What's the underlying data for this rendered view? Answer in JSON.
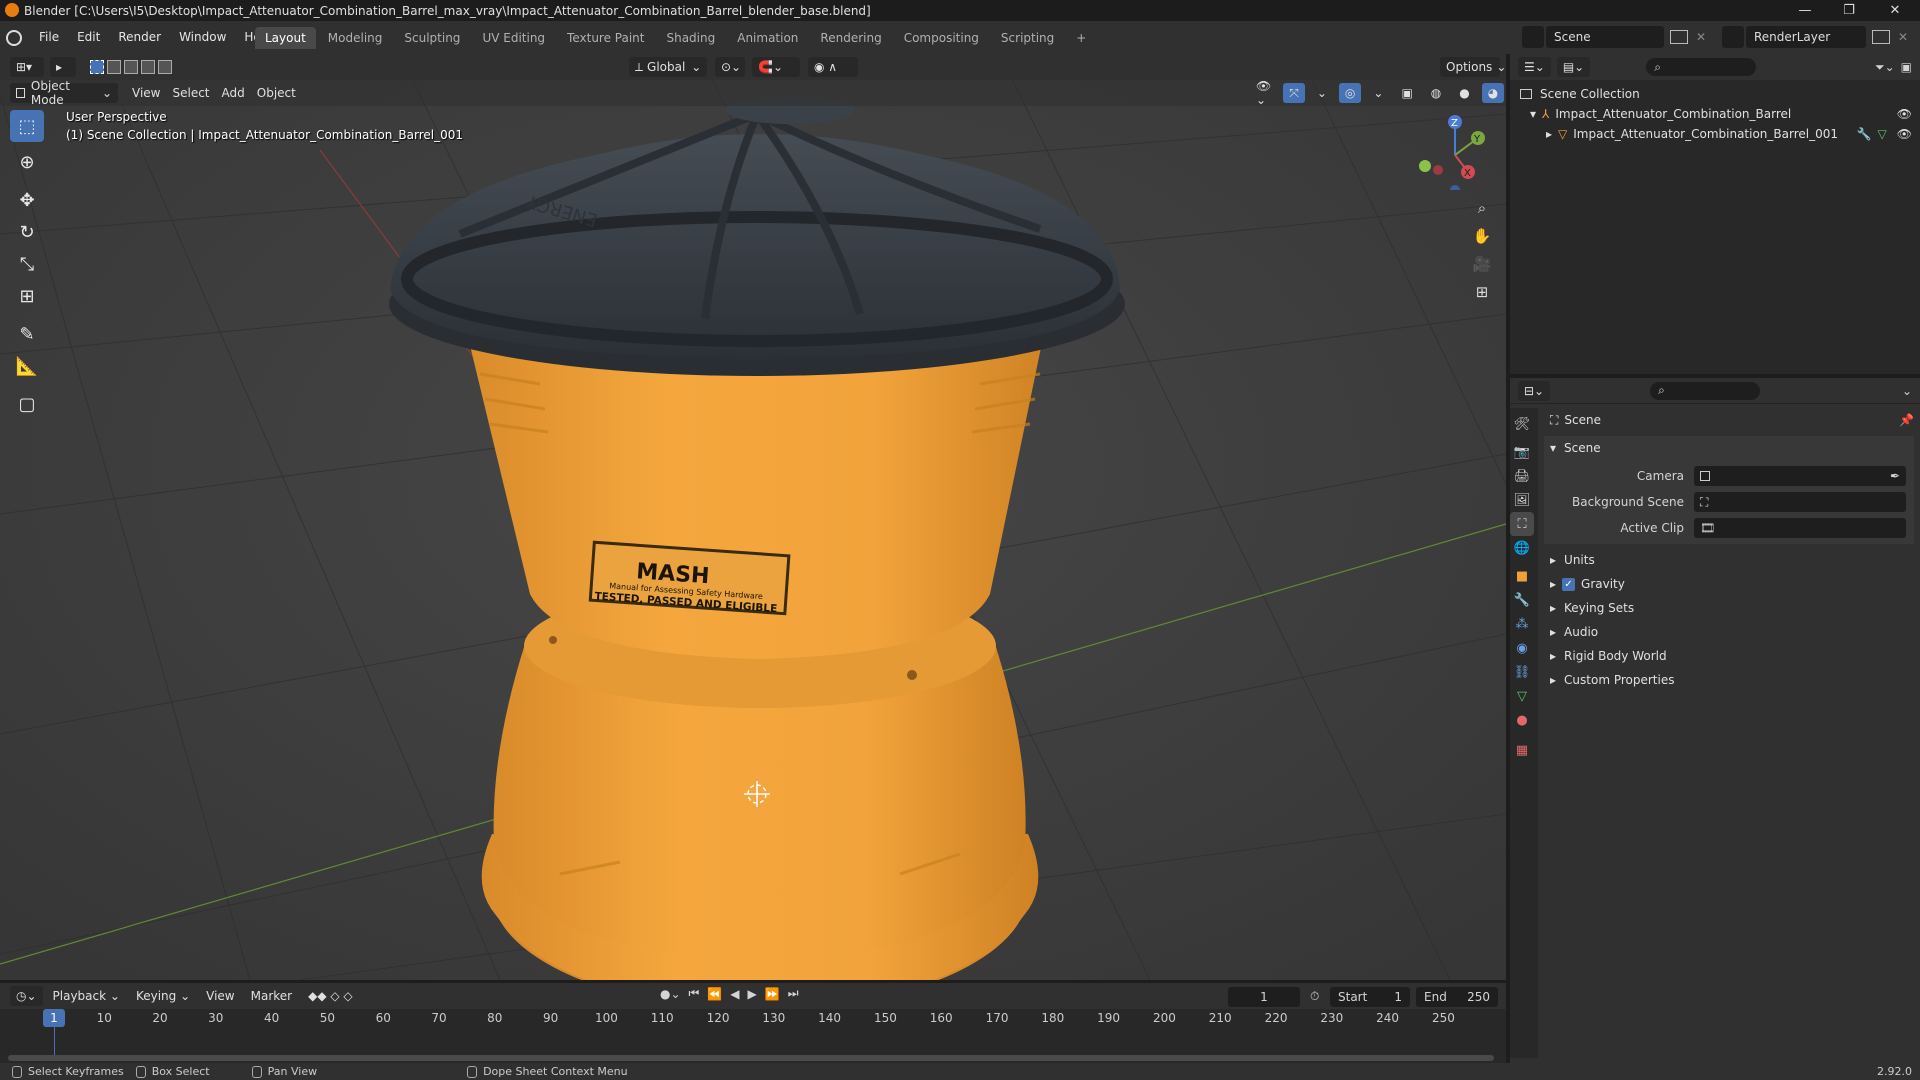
{
  "titlebar": {
    "title": "Blender [C:\\Users\\I5\\Desktop\\Impact_Attenuator_Combination_Barrel_max_vray\\Impact_Attenuator_Combination_Barrel_blender_base.blend]",
    "minimize": "—",
    "maximize": "❐",
    "close": "✕"
  },
  "menu": {
    "items": [
      "File",
      "Edit",
      "Render",
      "Window",
      "Help"
    ],
    "workspaces": [
      "Layout",
      "Modeling",
      "Sculpting",
      "UV Editing",
      "Texture Paint",
      "Shading",
      "Animation",
      "Rendering",
      "Compositing",
      "Scripting"
    ],
    "active_workspace": "Layout",
    "add_workspace": "+",
    "scene_name": "Scene",
    "render_layer": "RenderLayer"
  },
  "viewport_header": {
    "transform_orientation": "Global",
    "options": "Options",
    "mode": "Object Mode",
    "menus": [
      "View",
      "Select",
      "Add",
      "Object"
    ]
  },
  "viewport_overlay": {
    "perspective": "User Perspective",
    "collection_info": "(1) Scene Collection | Impact_Attenuator_Combination_Barrel_001"
  },
  "model": {
    "label_brand": "MASH",
    "label_line1": "Manual for Assessing Safety Hardware",
    "label_line2": "TESTED, PASSED AND ELIGIBLE",
    "lid_emboss": "ENERGY",
    "colors": {
      "barrel": "#f0a03a",
      "lid": "#343a41",
      "background": "#3b3b3b",
      "accent": "#4772b3"
    }
  },
  "gizmo": {
    "z": "Z",
    "y": "Y",
    "x": "X"
  },
  "outliner": {
    "root": "Scene Collection",
    "collection": "Impact_Attenuator_Combination_Barrel",
    "object": "Impact_Attenuator_Combination_Barrel_001"
  },
  "properties": {
    "context": "Scene",
    "panel_scene": "Scene",
    "fields": [
      {
        "label": "Camera",
        "value": ""
      },
      {
        "label": "Background Scene",
        "value": ""
      },
      {
        "label": "Active Clip",
        "value": ""
      }
    ],
    "subpanels": [
      "Units",
      "Gravity",
      "Keying Sets",
      "Audio",
      "Rigid Body World",
      "Custom Properties"
    ],
    "gravity_checked": true
  },
  "timeline": {
    "menus": [
      "Playback",
      "Keying",
      "View",
      "Marker"
    ],
    "current_frame": "1",
    "start_label": "Start",
    "start": "1",
    "end_label": "End",
    "end": "250",
    "ticks": [
      "1",
      "10",
      "20",
      "30",
      "40",
      "50",
      "60",
      "70",
      "80",
      "90",
      "100",
      "110",
      "120",
      "130",
      "140",
      "150",
      "160",
      "170",
      "180",
      "190",
      "200",
      "210",
      "220",
      "230",
      "240",
      "250"
    ]
  },
  "statusbar": {
    "select": "Select Keyframes",
    "box": "Box Select",
    "pan": "Pan View",
    "context_menu": "Dope Sheet Context Menu",
    "version": "2.92.0"
  }
}
